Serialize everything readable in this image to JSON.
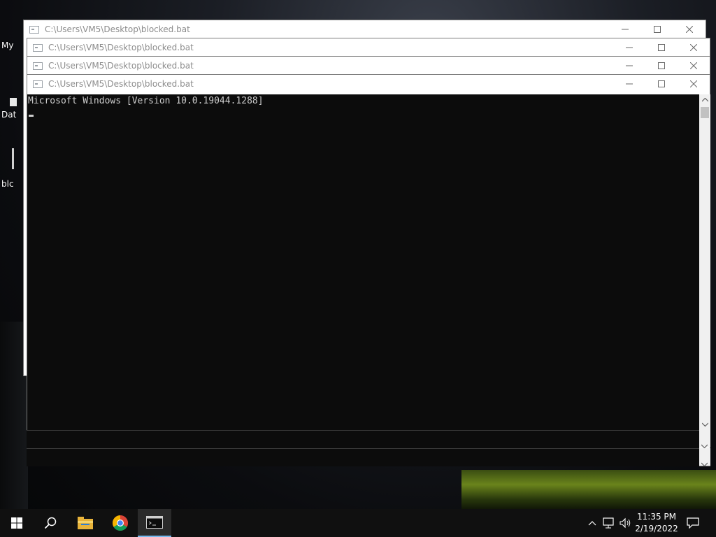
{
  "desktop": {
    "labels": [
      "My",
      "Dat",
      "blc"
    ]
  },
  "windows": [
    {
      "title": "C:\\Users\\VM5\\Desktop\\blocked.bat"
    },
    {
      "title": "C:\\Users\\VM5\\Desktop\\blocked.bat"
    },
    {
      "title": "C:\\Users\\VM5\\Desktop\\blocked.bat"
    },
    {
      "title": "C:\\Users\\VM5\\Desktop\\blocked.bat"
    }
  ],
  "console": {
    "line1": "Microsoft Windows [Version 10.0.19044.1288]"
  },
  "icons": {
    "window_icon": "console-icon",
    "minimize": "minimize-icon",
    "maximize": "maximize-icon",
    "close": "close-icon"
  },
  "taskbar": {
    "start": "windows-start-icon",
    "search": "search-icon",
    "explorer": "file-explorer-icon",
    "chrome": "chrome-icon",
    "terminal": "command-prompt-icon",
    "tray": [
      "chevron-up-icon",
      "network-icon",
      "volume-icon"
    ],
    "time": "11:35 PM",
    "date": "2/19/2022",
    "notifications": "notification-icon"
  },
  "colors": {
    "console_bg": "#0c0c0c",
    "console_text": "#cccccc",
    "taskbar_bg": "#101010",
    "accent": "#76b9ed"
  }
}
